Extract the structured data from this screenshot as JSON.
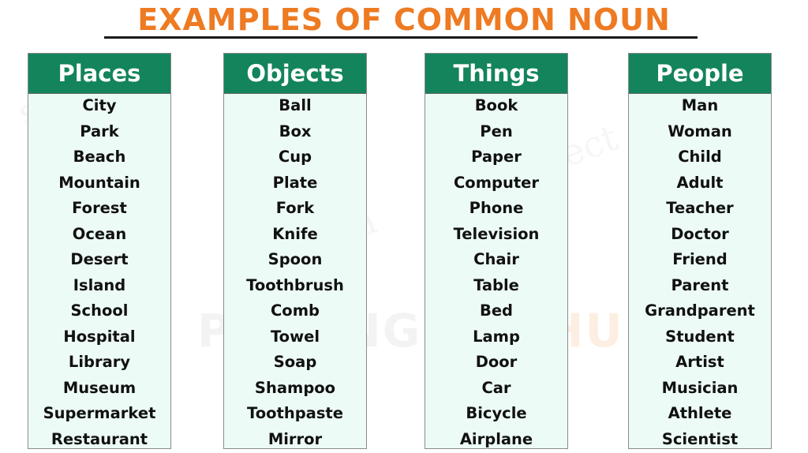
{
  "title": "EXAMPLES OF COMMON NOUN",
  "watermark": {
    "main": "PROENGLISH",
    "accent": "HUB"
  },
  "colors": {
    "title": "#ee7a22",
    "header_bg": "#13845b",
    "list_bg": "#edfbf7"
  },
  "columns": [
    {
      "heading": "Places",
      "items": [
        "City",
        "Park",
        "Beach",
        "Mountain",
        "Forest",
        "Ocean",
        "Desert",
        "Island",
        "School",
        "Hospital",
        "Library",
        "Museum",
        "Supermarket",
        "Restaurant"
      ]
    },
    {
      "heading": "Objects",
      "items": [
        "Ball",
        "Box",
        "Cup",
        "Plate",
        "Fork",
        "Knife",
        "Spoon",
        "Toothbrush",
        "Comb",
        "Towel",
        "Soap",
        "Shampoo",
        "Toothpaste",
        "Mirror"
      ]
    },
    {
      "heading": "Things",
      "items": [
        "Book",
        "Pen",
        "Paper",
        "Computer",
        "Phone",
        "Television",
        "Chair",
        "Table",
        "Bed",
        "Lamp",
        "Door",
        "Car",
        "Bicycle",
        "Airplane"
      ]
    },
    {
      "heading": "People",
      "items": [
        "Man",
        "Woman",
        "Child",
        "Adult",
        "Teacher",
        "Doctor",
        "Friend",
        "Parent",
        "Grandparent",
        "Student",
        "Artist",
        "Musician",
        "Athlete",
        "Scientist"
      ]
    }
  ]
}
